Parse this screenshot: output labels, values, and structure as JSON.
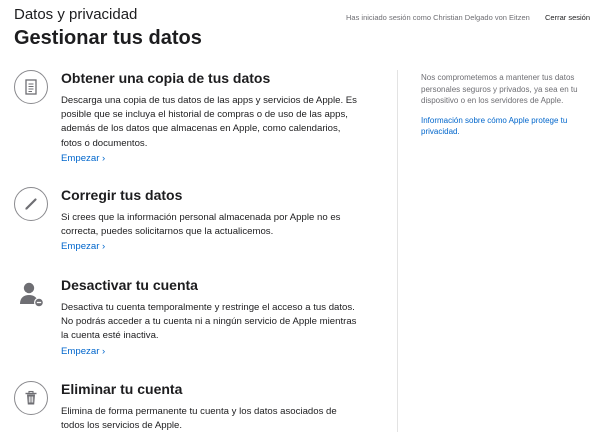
{
  "header": {
    "brand": "Datos y privacidad",
    "signed_in": "Has iniciado sesión como Christian Delgado von Eitzen",
    "signout": "Cerrar sesión"
  },
  "page": {
    "title": "Gestionar tus datos"
  },
  "sections": [
    {
      "icon": "document-icon",
      "title": "Obtener una copia de tus datos",
      "desc": "Descarga una copia de tus datos de las apps y servicios de Apple. Es posible que se incluya el historial de compras o de uso de las apps, además de los datos que almacenas en Apple, como calendarios, fotos o documentos.",
      "link": "Empezar ›"
    },
    {
      "icon": "pencil-icon",
      "title": "Corregir tus datos",
      "desc": "Si crees que la información personal almacenada por Apple no es correcta, puedes solicitarnos que la actualicemos.",
      "link": "Empezar ›"
    },
    {
      "icon": "user-minus-icon",
      "title": "Desactivar tu cuenta",
      "desc": "Desactiva tu cuenta temporalmente y restringe el acceso a tus datos. No podrás acceder a tu cuenta ni a ningún servicio de Apple mientras la cuenta esté inactiva.",
      "link": "Empezar ›"
    },
    {
      "icon": "trash-icon",
      "title": "Eliminar tu cuenta",
      "desc": "Elimina de forma permanente tu cuenta y los datos asociados de todos los servicios de Apple.",
      "link": ""
    }
  ],
  "aside": {
    "text": "Nos comprometemos a mantener tus datos personales seguros y privados, ya sea en tu dispositivo o en los servidores de Apple.",
    "link": "Información sobre cómo Apple protege tu privacidad."
  }
}
